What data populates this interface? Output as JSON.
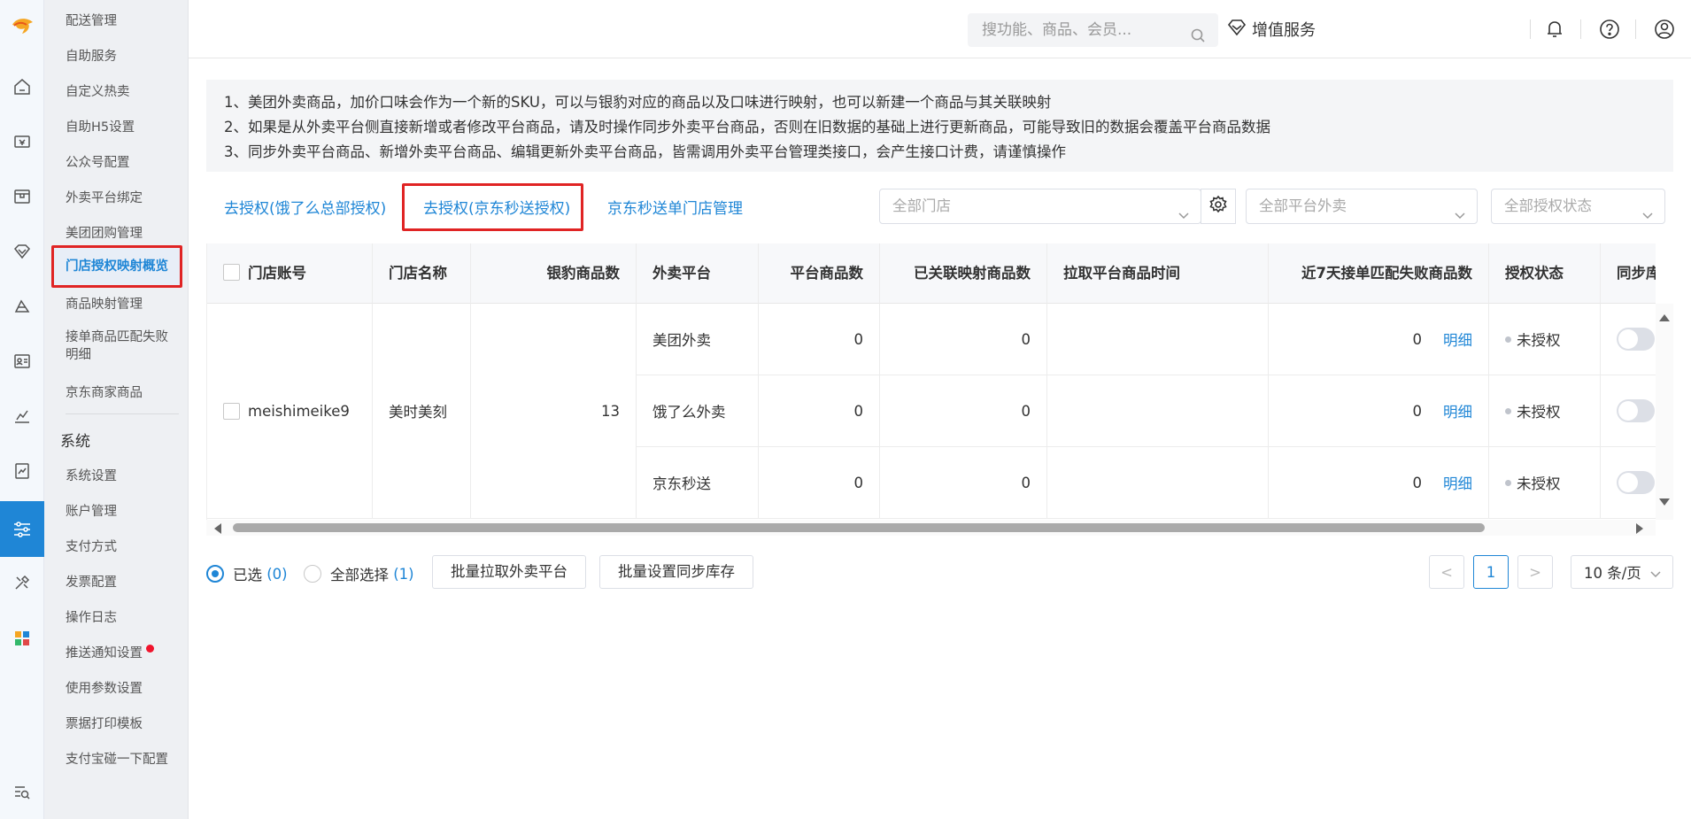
{
  "header": {
    "search_placeholder": "搜功能、商品、会员...",
    "value_added_service": "增值服务"
  },
  "menu": {
    "items": [
      "配送管理",
      "自助服务",
      "自定义热卖",
      "自助H5设置",
      "公众号配置",
      "外卖平台绑定",
      "美团团购管理",
      "门店授权映射概览",
      "商品映射管理",
      "接单商品匹配失败明细",
      "京东商家商品"
    ],
    "section_title": "系统",
    "system_items": [
      "系统设置",
      "账户管理",
      "支付方式",
      "发票配置",
      "操作日志",
      "推送通知设置",
      "使用参数设置",
      "票据打印模板",
      "支付宝碰一下配置"
    ]
  },
  "notice": {
    "lines": [
      "1、美团外卖商品，加价口味会作为一个新的SKU，可以与银豹对应的商品以及口味进行映射，也可以新建一个商品与其关联映射",
      "2、如果是从外卖平台侧直接新增或者修改平台商品，请及时操作同步外卖平台商品，否则在旧数据的基础上进行更新商品，可能导致旧的数据会覆盖平台商品数据",
      "3、同步外卖平台商品、新增外卖平台商品、编辑更新外卖平台商品，皆需调用外卖平台管理类接口，会产生接口计费，请谨慎操作"
    ]
  },
  "toolbar": {
    "auth_eleme": "去授权(饿了么总部授权)",
    "auth_jd": "去授权(京东秒送授权)",
    "jd_store_mgmt": "京东秒送单门店管理",
    "filter_store": "全部门店",
    "filter_platform": "全部平台外卖",
    "filter_auth_status": "全部授权状态"
  },
  "table": {
    "headers": [
      "门店账号",
      "门店名称",
      "银豹商品数",
      "外卖平台",
      "平台商品数",
      "已关联映射商品数",
      "拉取平台商品时间",
      "近7天接单匹配失败商品数",
      "授权状态",
      "同步库存"
    ],
    "store": {
      "account": "meishimeike9",
      "name": "美时美刻",
      "product_count": "13"
    },
    "rows": [
      {
        "platform": "美团外卖",
        "platform_count": "0",
        "mapped_count": "0",
        "pull_time": "",
        "fail_count": "0",
        "detail": "明细",
        "auth_status": "未授权",
        "sync_stock": false
      },
      {
        "platform": "饿了么外卖",
        "platform_count": "0",
        "mapped_count": "0",
        "pull_time": "",
        "fail_count": "0",
        "detail": "明细",
        "auth_status": "未授权",
        "sync_stock": false
      },
      {
        "platform": "京东秒送",
        "platform_count": "0",
        "mapped_count": "0",
        "pull_time": "",
        "fail_count": "0",
        "detail": "明细",
        "auth_status": "未授权",
        "sync_stock": false
      }
    ]
  },
  "footer": {
    "selected_label": "已选",
    "selected_count": "(0)",
    "select_all_label": "全部选择",
    "select_all_count": "(1)",
    "batch_pull": "批量拉取外卖平台",
    "batch_sync": "批量设置同步库存",
    "pagination": {
      "prev": "<",
      "current": "1",
      "next": ">",
      "page_size": "10 条/页"
    }
  },
  "colors": {
    "accent": "#1f86d6",
    "highlight_box": "#e02424",
    "notify_dot": "#f0142c"
  }
}
